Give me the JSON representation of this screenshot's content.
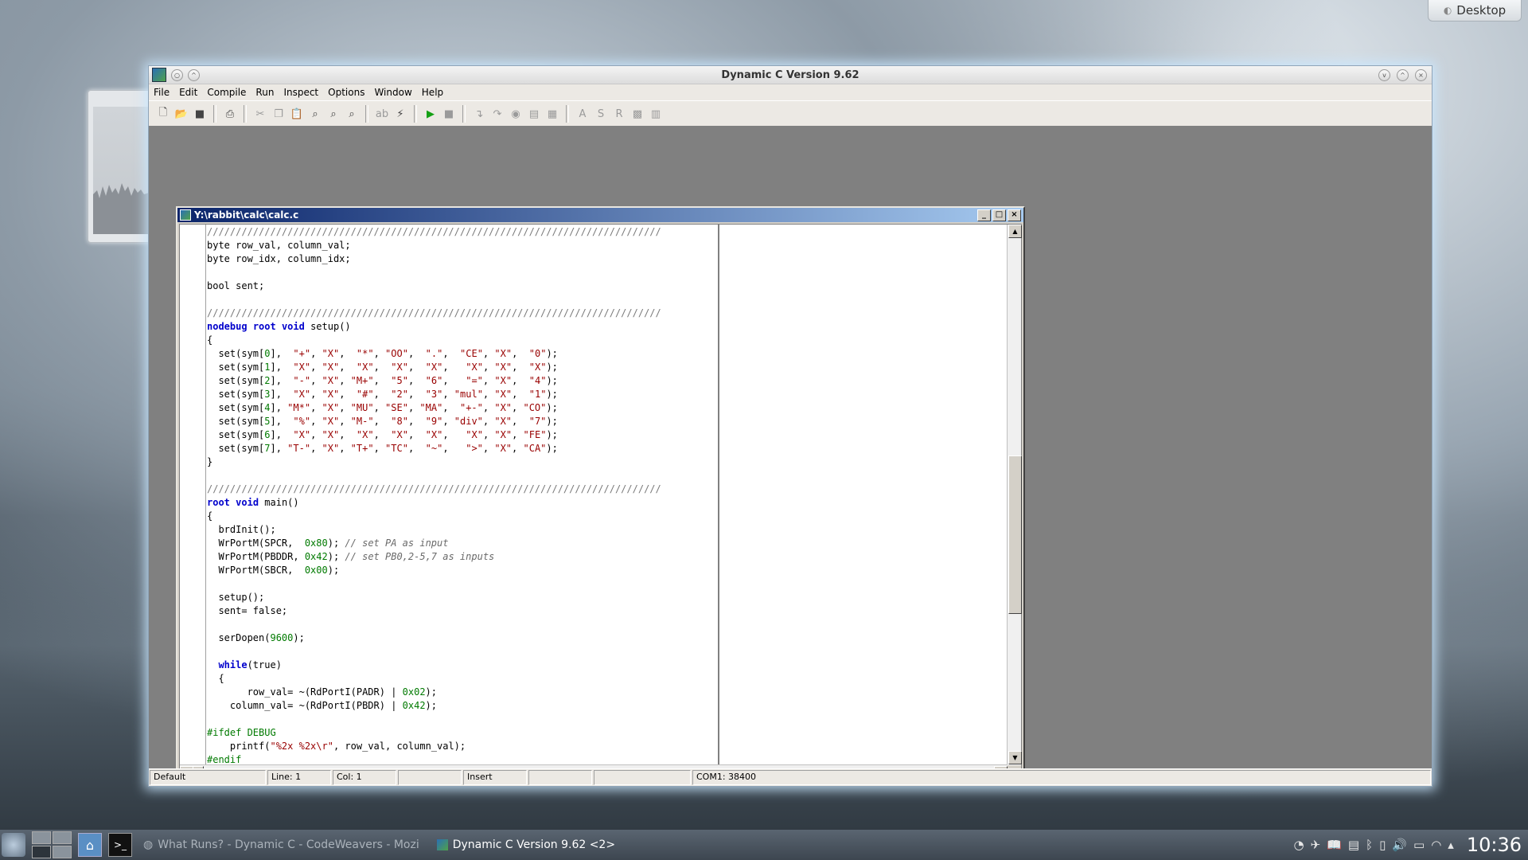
{
  "desktop": {
    "button_label": "Desktop"
  },
  "app": {
    "title": "Dynamic C Version 9.62",
    "menu": [
      "File",
      "Edit",
      "Compile",
      "Run",
      "Inspect",
      "Options",
      "Window",
      "Help"
    ],
    "toolbar_icons": [
      "new-file-icon",
      "open-file-icon",
      "save-icon",
      "print-icon",
      "cut-icon",
      "copy-icon",
      "paste-icon",
      "find-icon",
      "find-next-icon",
      "find-prev-icon",
      "replace-icon",
      "compile-icon",
      "run-icon",
      "stop-icon",
      "step-into-icon",
      "step-over-icon",
      "toggle-breakpoint-icon",
      "watch-icon",
      "watch-list-icon",
      "assembly-icon",
      "stdio-icon",
      "registers-icon",
      "memory-dump-icon",
      "stack-icon"
    ],
    "statusbar": {
      "mode": "Default",
      "line": "Line: 1",
      "col": "Col: 1",
      "blank1": "",
      "insert": "Insert",
      "blank2": "",
      "blank3": "",
      "com": "COM1: 38400"
    }
  },
  "editor": {
    "title": "Y:\\rabbit\\calc\\calc.c",
    "code_lines": [
      "///////////////////////////////////////////////////////////////////////////////",
      "byte row_val, column_val;",
      "byte row_idx, column_idx;",
      "",
      "bool sent;",
      "",
      "///////////////////////////////////////////////////////////////////////////////",
      "nodebug root void setup()",
      "{",
      "  set(sym[0],  \"+\", \"X\",  \"*\", \"OO\",  \".\",  \"CE\", \"X\",  \"0\");",
      "  set(sym[1],  \"X\", \"X\",  \"X\",  \"X\",  \"X\",   \"X\", \"X\",  \"X\");",
      "  set(sym[2],  \"-\", \"X\", \"M+\",  \"5\",  \"6\",   \"=\", \"X\",  \"4\");",
      "  set(sym[3],  \"X\", \"X\",  \"#\",  \"2\",  \"3\", \"mul\", \"X\",  \"1\");",
      "  set(sym[4], \"M*\", \"X\", \"MU\", \"SE\", \"MA\",  \"+-\", \"X\", \"CO\");",
      "  set(sym[5],  \"%\", \"X\", \"M-\",  \"8\",  \"9\", \"div\", \"X\",  \"7\");",
      "  set(sym[6],  \"X\", \"X\",  \"X\",  \"X\",  \"X\",   \"X\", \"X\", \"FE\");",
      "  set(sym[7], \"T-\", \"X\", \"T+\", \"TC\",  \"~\",   \">\", \"X\", \"CA\");",
      "}",
      "",
      "///////////////////////////////////////////////////////////////////////////////",
      "root void main()",
      "{",
      "  brdInit();",
      "  WrPortM(SPCR,  0x80); // set PA as input",
      "  WrPortM(PBDDR, 0x42); // set PB0,2-5,7 as inputs",
      "  WrPortM(SBCR,  0x00);",
      "",
      "  setup();",
      "  sent= false;",
      "",
      "  serDopen(9600);",
      "",
      "  while(true)",
      "  {",
      "       row_val= ~(RdPortI(PADR) | 0x02);",
      "    column_val= ~(RdPortI(PBDR) | 0x42);",
      "",
      "#ifdef DEBUG",
      "    printf(\"%2x %2x\\r\", row_val, column_val);",
      "#endif"
    ]
  },
  "taskbar": {
    "items": [
      {
        "label": "What Runs? - Dynamic C - CodeWeavers - Mozi",
        "active": false
      },
      {
        "label": "Dynamic C Version 9.62 <2>",
        "active": true
      }
    ],
    "clock": "10:36"
  }
}
